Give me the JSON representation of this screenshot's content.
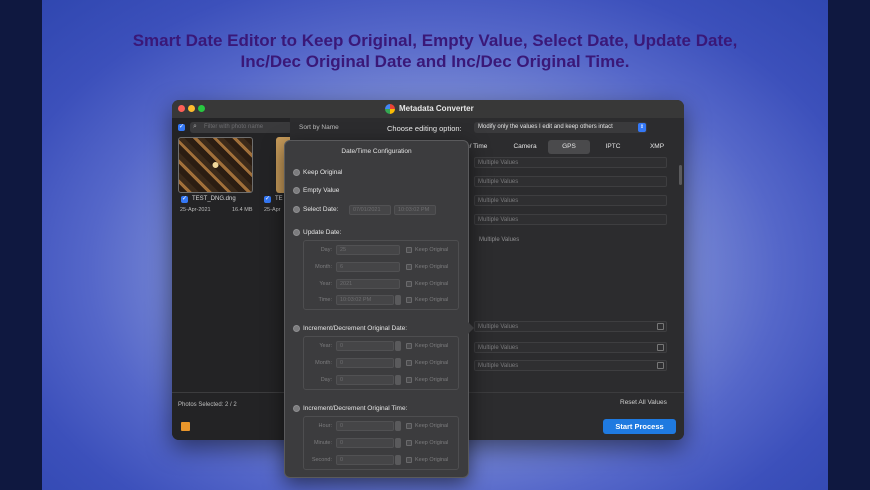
{
  "headline": {
    "line1": "Smart Date Editor to Keep Original, Empty Value, Select Date, Update Date,",
    "line2": "Inc/Dec Original Date and Inc/Dec Original Time."
  },
  "window": {
    "title": "Metadata Converter"
  },
  "sidebar": {
    "search_placeholder": "Filter with photo name",
    "sort_label": "Sort by Name",
    "files": [
      {
        "name": "TEST_DNG.dng",
        "date": "25-Apr-2021",
        "size": "16.4 MB"
      },
      {
        "name": "TE",
        "date": "25-Apr",
        "size": ""
      }
    ],
    "photos_selected": "Photos Selected: 2 / 2"
  },
  "editing": {
    "label": "Choose editing option:",
    "value": "Modify only the values I edit and keep others intact"
  },
  "tabs": [
    "ate/ Time",
    "Camera",
    "GPS",
    "IPTC",
    "XMP"
  ],
  "fields": {
    "multiple_values": "Multiple Values"
  },
  "reset_all": "Reset All Values",
  "start_process": "Start Process",
  "popover": {
    "title": "Date/Time Configuration",
    "options": {
      "keep_original": "Keep Original",
      "empty_value": "Empty Value",
      "select_date": "Select Date:",
      "update_date": "Update Date:",
      "inc_dec_date": "Increment/Decrement Original Date:",
      "inc_dec_time": "Increment/Decrement Original Time:"
    },
    "select_date_value": "07/01/2021",
    "select_time_value": "10:03:02 PM",
    "update_rows": [
      {
        "label": "Day:",
        "value": "25"
      },
      {
        "label": "Month:",
        "value": "6"
      },
      {
        "label": "Year:",
        "value": "2021"
      },
      {
        "label": "Time:",
        "value": "10:03:02 PM"
      }
    ],
    "date_rows": [
      {
        "label": "Year:",
        "value": "0"
      },
      {
        "label": "Month:",
        "value": "0"
      },
      {
        "label": "Day:",
        "value": "0"
      }
    ],
    "time_rows": [
      {
        "label": "Hour:",
        "value": "0"
      },
      {
        "label": "Minute:",
        "value": "0"
      },
      {
        "label": "Second:",
        "value": "0"
      }
    ],
    "keep_original_small": "Keep Original"
  }
}
